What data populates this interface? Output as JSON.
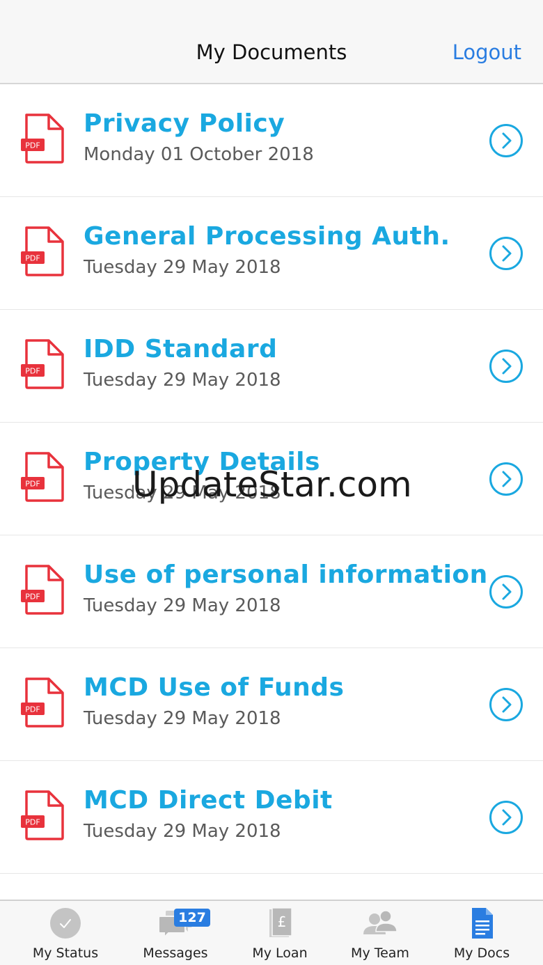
{
  "header": {
    "title": "My Documents",
    "logout_label": "Logout"
  },
  "documents": [
    {
      "title": "Privacy Policy",
      "date": "Monday 01 October 2018",
      "icon": "pdf-icon",
      "badge": "PDF"
    },
    {
      "title": "General Processing Auth.",
      "date": "Tuesday 29 May 2018",
      "icon": "pdf-icon",
      "badge": "PDF"
    },
    {
      "title": "IDD Standard",
      "date": "Tuesday 29 May 2018",
      "icon": "pdf-icon",
      "badge": "PDF"
    },
    {
      "title": "Property Details",
      "date": "Tuesday 29 May 2018",
      "icon": "pdf-icon",
      "badge": "PDF"
    },
    {
      "title": "Use of personal information",
      "date": "Tuesday 29 May 2018",
      "icon": "pdf-icon",
      "badge": "PDF"
    },
    {
      "title": "MCD Use of Funds",
      "date": "Tuesday 29 May 2018",
      "icon": "pdf-icon",
      "badge": "PDF"
    },
    {
      "title": "MCD Direct Debit",
      "date": "Tuesday 29 May 2018",
      "icon": "pdf-icon",
      "badge": "PDF"
    }
  ],
  "watermark": "UpdateStar.com",
  "tabbar": {
    "tabs": [
      {
        "label": "My Status",
        "icon": "check-circle-icon"
      },
      {
        "label": "Messages",
        "icon": "chat-bubbles-icon"
      },
      {
        "label": "My Loan",
        "icon": "pound-document-icon"
      },
      {
        "label": "My Team",
        "icon": "people-icon"
      },
      {
        "label": "My Docs",
        "icon": "document-icon"
      }
    ],
    "messages_badge": "127",
    "active_tab": "My Docs"
  },
  "colors": {
    "accent": "#1aa8e0",
    "link": "#2a7de1",
    "pdf_red": "#e8323c",
    "inactive_icon": "#b8b8b8"
  }
}
